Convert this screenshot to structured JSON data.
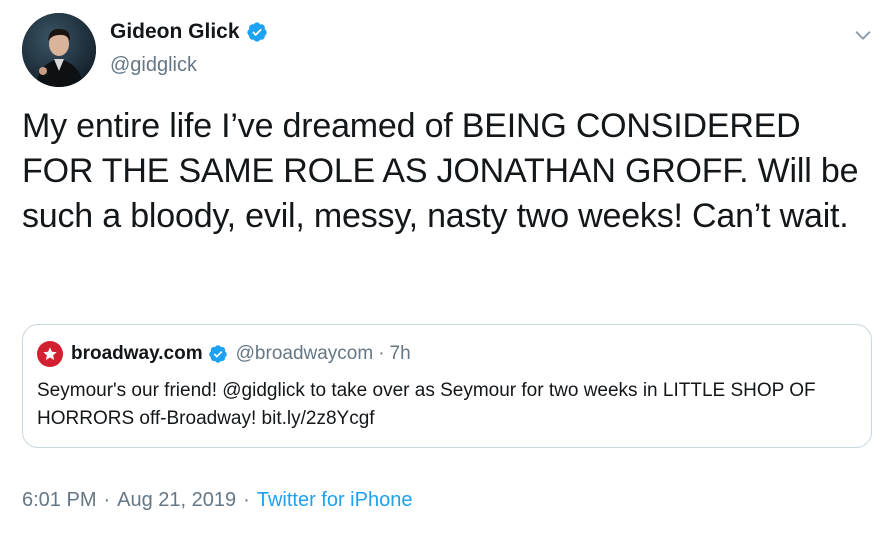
{
  "author": {
    "display_name": "Gideon Glick",
    "handle": "@gidglick",
    "verified_icon": "verified-badge-icon"
  },
  "tweet": {
    "text": "My entire life I’ve dreamed of BEING CONSIDERED FOR THE SAME ROLE AS JONATHAN GROFF. Will be such a bloody, evil, messy, nasty two weeks! Can’t wait."
  },
  "quoted_tweet": {
    "display_name": "broadway.com",
    "handle": "@broadwaycom",
    "separator": "·",
    "time": "7h",
    "text": "Seymour's our friend! @gidglick to take over as Seymour for two weeks in LITTLE SHOP OF HORRORS off-Broadway! bit.ly/2z8Ycgf"
  },
  "meta": {
    "time": "6:01 PM",
    "separator": "·",
    "date": "Aug 21, 2019",
    "source": "Twitter for iPhone"
  },
  "colors": {
    "verified": "#1da1f2",
    "link": "#1da1f2",
    "secondary_text": "#657786",
    "broadway_brand": "#d32030"
  }
}
